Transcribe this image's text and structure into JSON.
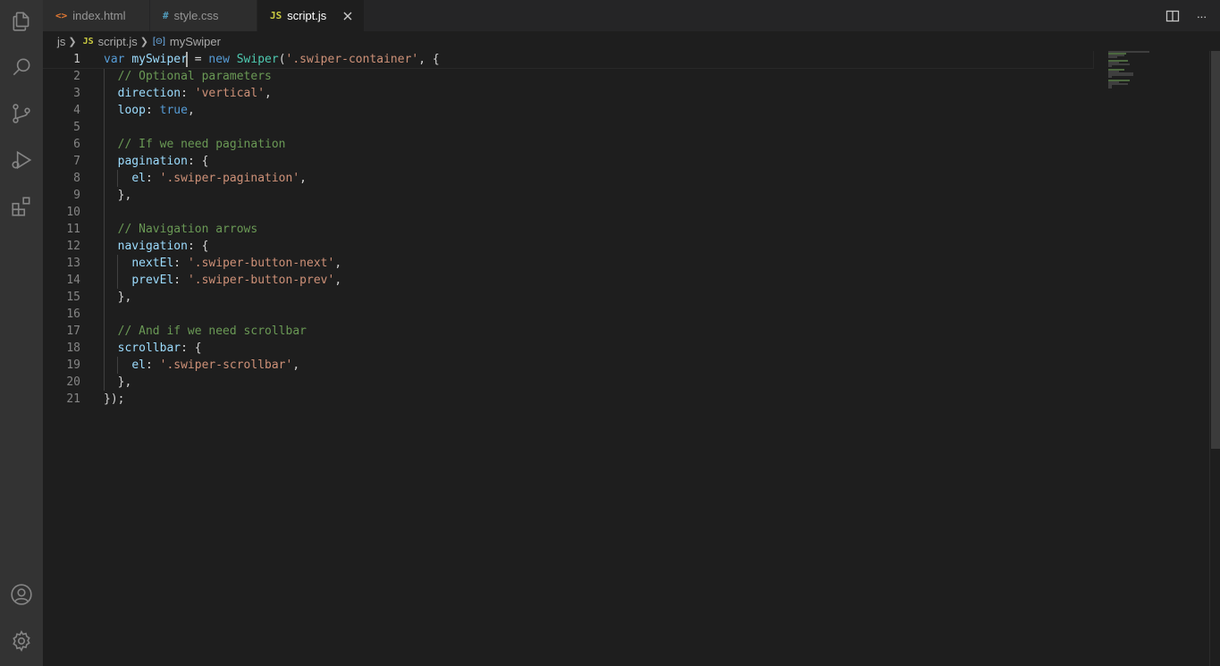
{
  "tabs": [
    {
      "label": "index.html",
      "icon": "<>",
      "icon_color": "#e37933"
    },
    {
      "label": "style.css",
      "icon": "#",
      "icon_color": "#519aba"
    },
    {
      "label": "script.js",
      "icon": "JS",
      "icon_color": "#cbcb41"
    }
  ],
  "breadcrumb": {
    "folder": "js",
    "file_icon": "JS",
    "file": "script.js",
    "symbol_icon": "[⊝]",
    "symbol": "mySwiper"
  },
  "editor": {
    "line_numbers": [
      "1",
      "2",
      "3",
      "4",
      "5",
      "6",
      "7",
      "8",
      "9",
      "10",
      "11",
      "12",
      "13",
      "14",
      "15",
      "16",
      "17",
      "18",
      "19",
      "20",
      "21"
    ],
    "current_line": 1
  },
  "icons": {
    "explorer": "files-icon",
    "search": "search-icon",
    "source_control": "source-control-icon",
    "run_debug": "run-debug-icon",
    "extensions": "extensions-icon",
    "accounts": "account-icon",
    "settings": "gear-icon",
    "split": "split-editor-icon",
    "more": "more-actions-icon",
    "close": "close-icon"
  },
  "more_glyph": "···",
  "close_glyph": "✕"
}
